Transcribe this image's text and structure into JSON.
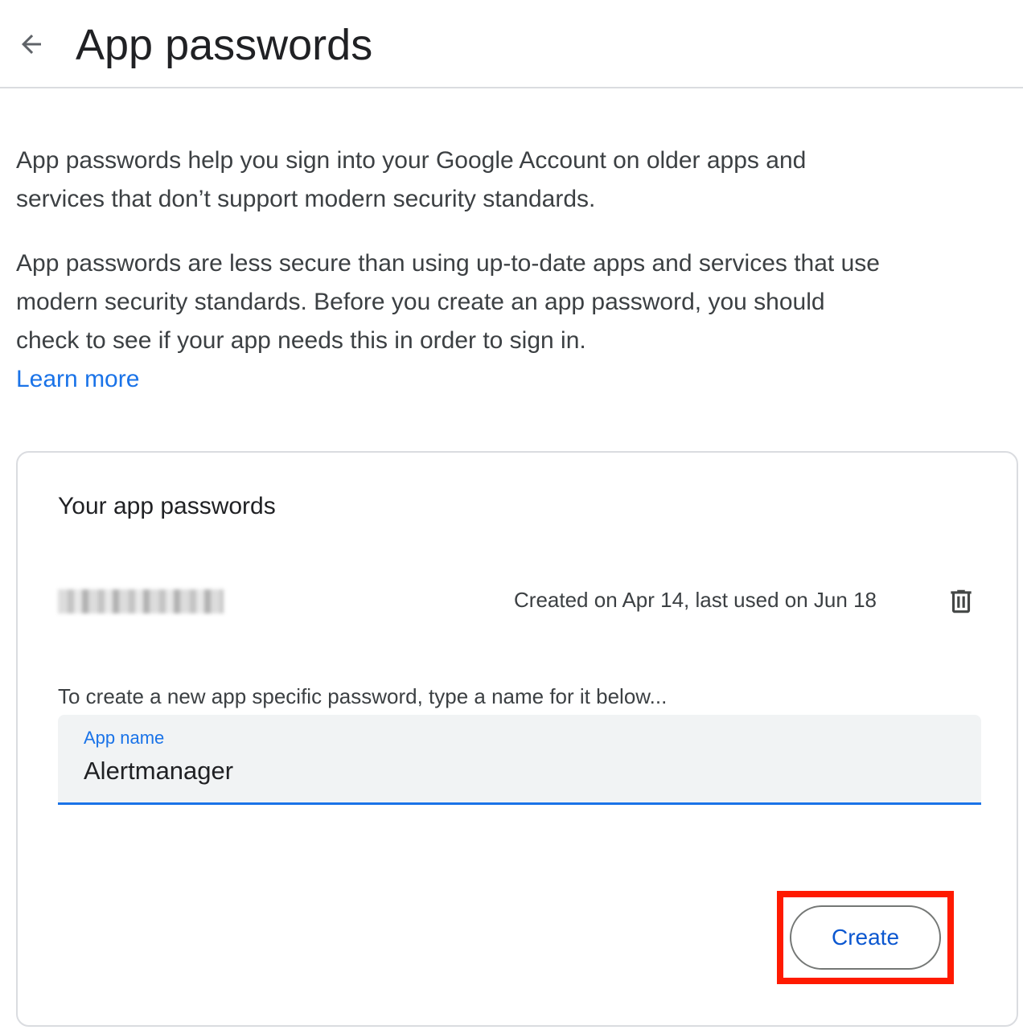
{
  "header": {
    "title": "App passwords"
  },
  "intro": {
    "paragraph_1": "App passwords help you sign into your Google Account on older apps and services that don’t support modern security standards.",
    "paragraph_2": "App passwords are less secure than using up-to-date apps and services that use modern security standards. Before you create an app password, you should check to see if your app needs this in order to sign in.",
    "learn_more": "Learn more"
  },
  "card": {
    "title": "Your app passwords",
    "passwords": [
      {
        "name_redacted": true,
        "meta": "Created on Apr 14, last used on Jun 18"
      }
    ],
    "create_hint": "To create a new app specific password, type a name for it below...",
    "field": {
      "label": "App name",
      "value": "Alertmanager"
    },
    "create_button": "Create"
  },
  "colors": {
    "accent": "#1a73e8",
    "button_text": "#0b57d0",
    "highlight": "#ff1a00"
  },
  "icons": {
    "back": "arrow-back-icon",
    "delete": "trash-icon"
  }
}
